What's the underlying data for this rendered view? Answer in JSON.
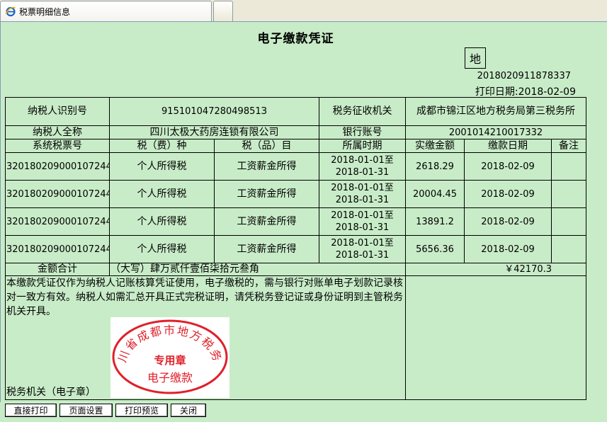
{
  "tabs": [
    {
      "label": "税票明细信息",
      "icon": "ie-icon"
    },
    {
      "label": ""
    }
  ],
  "document": {
    "title": "电子缴款凭证",
    "region_mark": "地",
    "serial_number": "2018020911878337",
    "print_date": "打印日期:2018-02-09"
  },
  "header_rows": {
    "taxpayer_id_label": "纳税人识别号",
    "taxpayer_id_value": "91510104728049851З",
    "tax_authority_label": "税务征收机关",
    "tax_authority_value": "成都市锦江区地方税务局第三税务所",
    "taxpayer_name_label": "纳税人全称",
    "taxpayer_name_value": "四川太极大药房连锁有限公司",
    "bank_account_label": "银行账号",
    "bank_account_value": "2001014210017332"
  },
  "columns": [
    "系统税票号",
    "税（费）种",
    "税（品）目",
    "所属时期",
    "实缴金额",
    "缴款日期",
    "备注"
  ],
  "rows": [
    {
      "ticket": "320180209000107244",
      "tax_type": "个人所得税",
      "item": "工资薪金所得",
      "period_start": "2018-01-01至",
      "period_end": "2018-01-31",
      "amount": "2618.29",
      "date": "2018-02-09",
      "note": ""
    },
    {
      "ticket": "320180209000107244",
      "tax_type": "个人所得税",
      "item": "工资薪金所得",
      "period_start": "2018-01-01至",
      "period_end": "2018-01-31",
      "amount": "20004.45",
      "date": "2018-02-09",
      "note": ""
    },
    {
      "ticket": "320180209000107244",
      "tax_type": "个人所得税",
      "item": "工资薪金所得",
      "period_start": "2018-01-01至",
      "period_end": "2018-01-31",
      "amount": "13891.2",
      "date": "2018-02-09",
      "note": ""
    },
    {
      "ticket": "320180209000107244",
      "tax_type": "个人所得税",
      "item": "工资薪金所得",
      "period_start": "2018-01-01至",
      "period_end": "2018-01-31",
      "amount": "5656.36",
      "date": "2018-02-09",
      "note": ""
    }
  ],
  "total": {
    "label": "金额合计",
    "uppercase": "（大写）肆万贰仟壹佰柒拾元叁角",
    "amount": "￥42170.3"
  },
  "notes": "本缴款凭证仅作为纳税人记账核算凭证使用，电子缴税的，需与银行对账单电子划款记录核对一致方有效。纳税人如需汇总开具正式完税证明，请凭税务登记证或身份证明到主管税务机关开具。",
  "seal": {
    "ring_text": "四川省成都市地方税务局",
    "center_text": "专用章",
    "bottom_text": "电子缴款",
    "color": "#e0202a"
  },
  "tax_office_label": "税务机关（电子章）",
  "buttons": {
    "print_direct": "直接打印",
    "page_setup": "页面设置",
    "print_preview": "打印预览",
    "close": "关闭"
  }
}
